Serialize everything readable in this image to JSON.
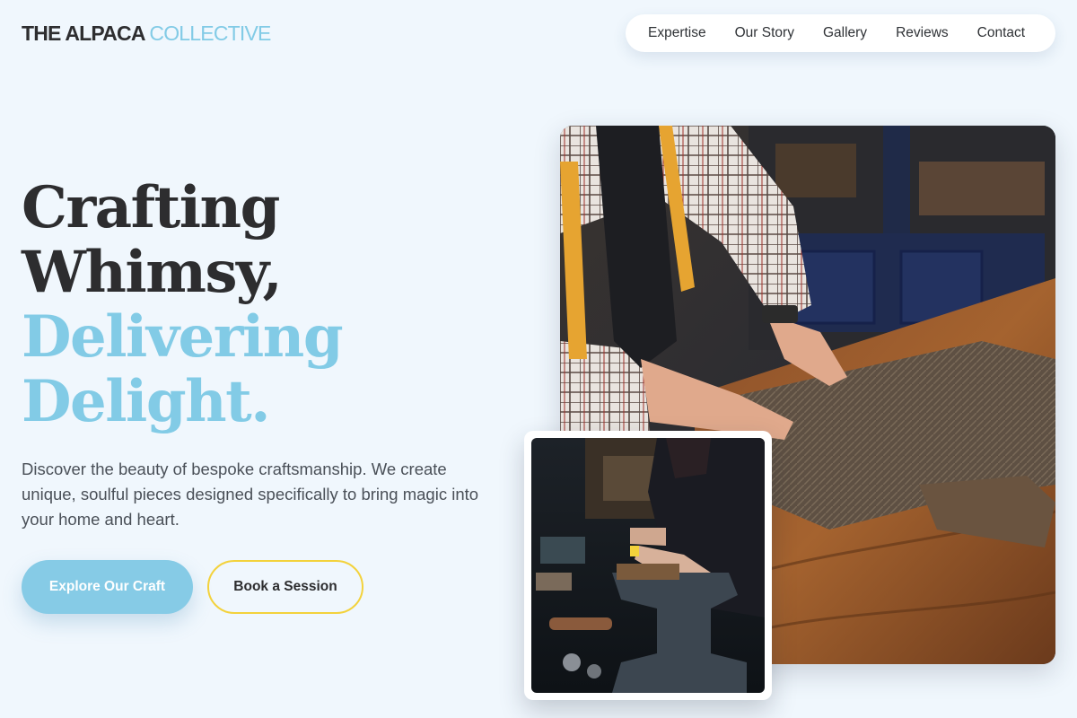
{
  "brand": {
    "part1": "THE ALPACA",
    "part2": "COLLECTIVE"
  },
  "nav": {
    "items": [
      {
        "label": "Expertise"
      },
      {
        "label": "Our Story"
      },
      {
        "label": "Gallery"
      },
      {
        "label": "Reviews"
      },
      {
        "label": "Contact"
      }
    ]
  },
  "hero": {
    "line1": "Crafting",
    "line2": "Whimsy,",
    "line3": "Delivering",
    "line4": "Delight.",
    "lead": "Discover the beauty of bespoke craftsmanship. We create unique, soulful pieces designed specifically to bring magic into your home and heart.",
    "primary_cta": "Explore Our Craft",
    "secondary_cta": "Book a Session"
  },
  "images": {
    "main": {
      "subject": "tailor-cutting-fabric-photo"
    },
    "inset": {
      "subject": "artisan-workbench-photo"
    }
  },
  "colors": {
    "background": "#f0f7fd",
    "accent_blue": "#82cbe6",
    "accent_yellow": "#f3d23c",
    "text_dark": "#2d2d2f"
  }
}
